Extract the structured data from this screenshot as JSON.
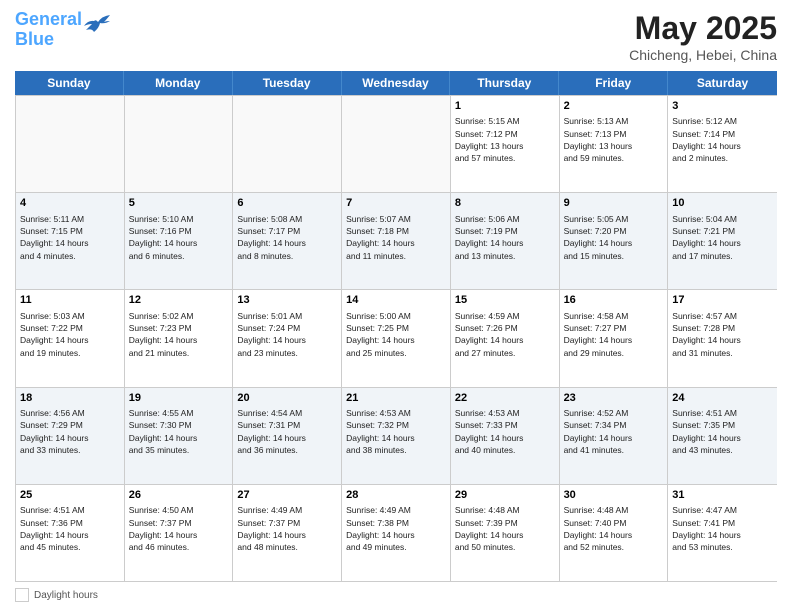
{
  "header": {
    "logo_line1": "General",
    "logo_line2": "Blue",
    "month_year": "May 2025",
    "location": "Chicheng, Hebei, China"
  },
  "weekdays": [
    "Sunday",
    "Monday",
    "Tuesday",
    "Wednesday",
    "Thursday",
    "Friday",
    "Saturday"
  ],
  "weeks": [
    [
      {
        "day": "",
        "info": ""
      },
      {
        "day": "",
        "info": ""
      },
      {
        "day": "",
        "info": ""
      },
      {
        "day": "",
        "info": ""
      },
      {
        "day": "1",
        "info": "Sunrise: 5:15 AM\nSunset: 7:12 PM\nDaylight: 13 hours\nand 57 minutes."
      },
      {
        "day": "2",
        "info": "Sunrise: 5:13 AM\nSunset: 7:13 PM\nDaylight: 13 hours\nand 59 minutes."
      },
      {
        "day": "3",
        "info": "Sunrise: 5:12 AM\nSunset: 7:14 PM\nDaylight: 14 hours\nand 2 minutes."
      }
    ],
    [
      {
        "day": "4",
        "info": "Sunrise: 5:11 AM\nSunset: 7:15 PM\nDaylight: 14 hours\nand 4 minutes."
      },
      {
        "day": "5",
        "info": "Sunrise: 5:10 AM\nSunset: 7:16 PM\nDaylight: 14 hours\nand 6 minutes."
      },
      {
        "day": "6",
        "info": "Sunrise: 5:08 AM\nSunset: 7:17 PM\nDaylight: 14 hours\nand 8 minutes."
      },
      {
        "day": "7",
        "info": "Sunrise: 5:07 AM\nSunset: 7:18 PM\nDaylight: 14 hours\nand 11 minutes."
      },
      {
        "day": "8",
        "info": "Sunrise: 5:06 AM\nSunset: 7:19 PM\nDaylight: 14 hours\nand 13 minutes."
      },
      {
        "day": "9",
        "info": "Sunrise: 5:05 AM\nSunset: 7:20 PM\nDaylight: 14 hours\nand 15 minutes."
      },
      {
        "day": "10",
        "info": "Sunrise: 5:04 AM\nSunset: 7:21 PM\nDaylight: 14 hours\nand 17 minutes."
      }
    ],
    [
      {
        "day": "11",
        "info": "Sunrise: 5:03 AM\nSunset: 7:22 PM\nDaylight: 14 hours\nand 19 minutes."
      },
      {
        "day": "12",
        "info": "Sunrise: 5:02 AM\nSunset: 7:23 PM\nDaylight: 14 hours\nand 21 minutes."
      },
      {
        "day": "13",
        "info": "Sunrise: 5:01 AM\nSunset: 7:24 PM\nDaylight: 14 hours\nand 23 minutes."
      },
      {
        "day": "14",
        "info": "Sunrise: 5:00 AM\nSunset: 7:25 PM\nDaylight: 14 hours\nand 25 minutes."
      },
      {
        "day": "15",
        "info": "Sunrise: 4:59 AM\nSunset: 7:26 PM\nDaylight: 14 hours\nand 27 minutes."
      },
      {
        "day": "16",
        "info": "Sunrise: 4:58 AM\nSunset: 7:27 PM\nDaylight: 14 hours\nand 29 minutes."
      },
      {
        "day": "17",
        "info": "Sunrise: 4:57 AM\nSunset: 7:28 PM\nDaylight: 14 hours\nand 31 minutes."
      }
    ],
    [
      {
        "day": "18",
        "info": "Sunrise: 4:56 AM\nSunset: 7:29 PM\nDaylight: 14 hours\nand 33 minutes."
      },
      {
        "day": "19",
        "info": "Sunrise: 4:55 AM\nSunset: 7:30 PM\nDaylight: 14 hours\nand 35 minutes."
      },
      {
        "day": "20",
        "info": "Sunrise: 4:54 AM\nSunset: 7:31 PM\nDaylight: 14 hours\nand 36 minutes."
      },
      {
        "day": "21",
        "info": "Sunrise: 4:53 AM\nSunset: 7:32 PM\nDaylight: 14 hours\nand 38 minutes."
      },
      {
        "day": "22",
        "info": "Sunrise: 4:53 AM\nSunset: 7:33 PM\nDaylight: 14 hours\nand 40 minutes."
      },
      {
        "day": "23",
        "info": "Sunrise: 4:52 AM\nSunset: 7:34 PM\nDaylight: 14 hours\nand 41 minutes."
      },
      {
        "day": "24",
        "info": "Sunrise: 4:51 AM\nSunset: 7:35 PM\nDaylight: 14 hours\nand 43 minutes."
      }
    ],
    [
      {
        "day": "25",
        "info": "Sunrise: 4:51 AM\nSunset: 7:36 PM\nDaylight: 14 hours\nand 45 minutes."
      },
      {
        "day": "26",
        "info": "Sunrise: 4:50 AM\nSunset: 7:37 PM\nDaylight: 14 hours\nand 46 minutes."
      },
      {
        "day": "27",
        "info": "Sunrise: 4:49 AM\nSunset: 7:37 PM\nDaylight: 14 hours\nand 48 minutes."
      },
      {
        "day": "28",
        "info": "Sunrise: 4:49 AM\nSunset: 7:38 PM\nDaylight: 14 hours\nand 49 minutes."
      },
      {
        "day": "29",
        "info": "Sunrise: 4:48 AM\nSunset: 7:39 PM\nDaylight: 14 hours\nand 50 minutes."
      },
      {
        "day": "30",
        "info": "Sunrise: 4:48 AM\nSunset: 7:40 PM\nDaylight: 14 hours\nand 52 minutes."
      },
      {
        "day": "31",
        "info": "Sunrise: 4:47 AM\nSunset: 7:41 PM\nDaylight: 14 hours\nand 53 minutes."
      }
    ]
  ],
  "footer": {
    "label": "Daylight hours"
  }
}
